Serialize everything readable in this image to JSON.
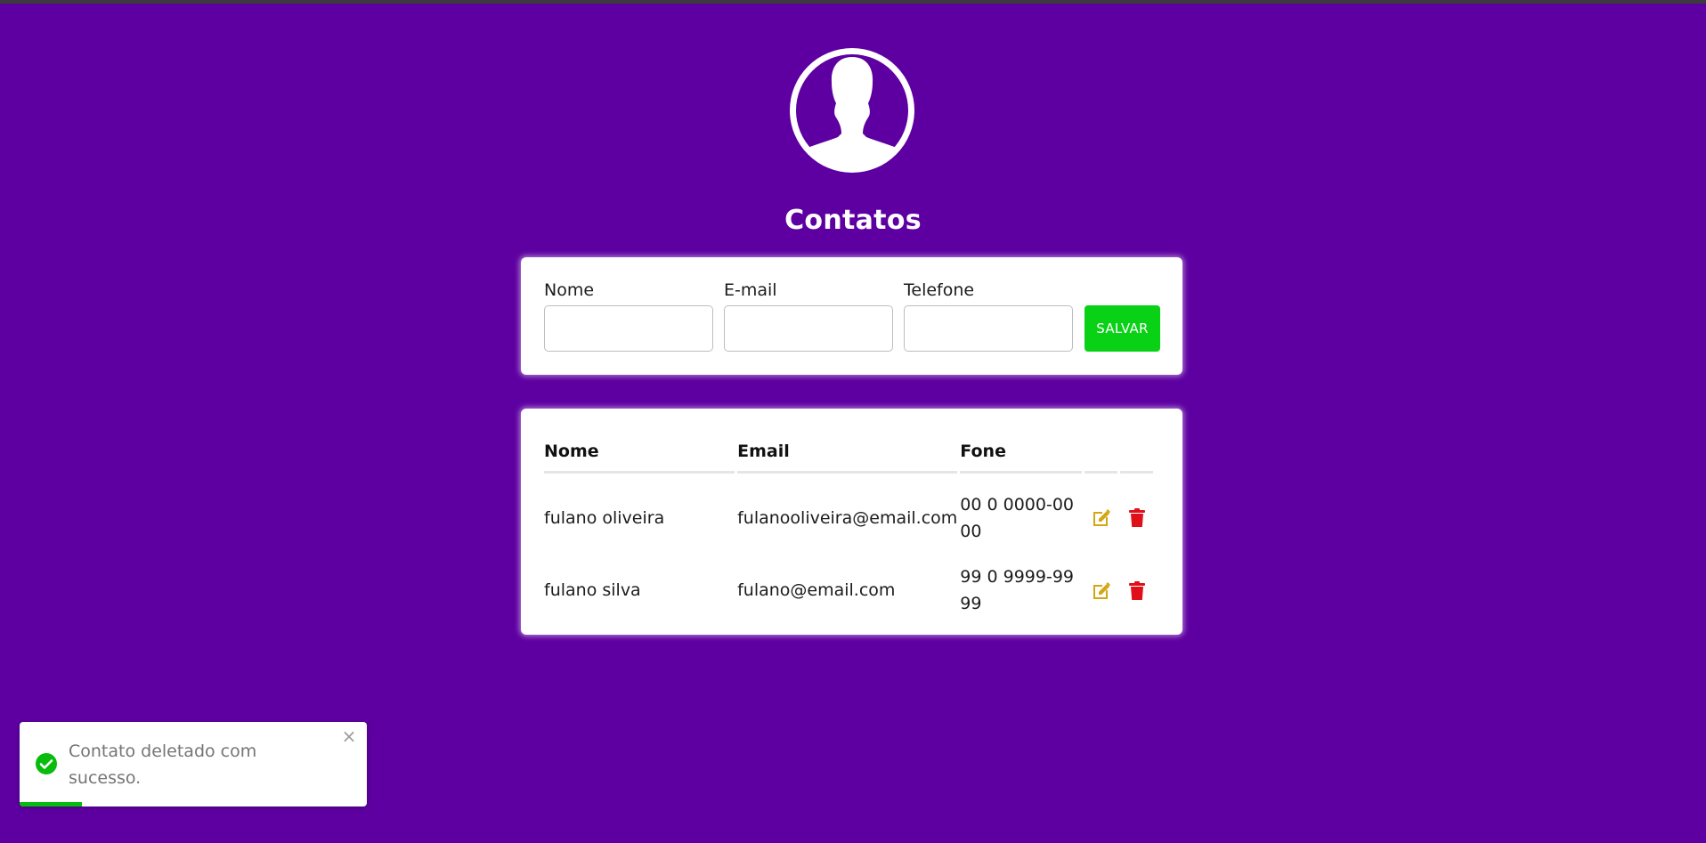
{
  "page": {
    "title": "Contatos"
  },
  "form": {
    "name_label": "Nome",
    "email_label": "E-mail",
    "phone_label": "Telefone",
    "name_value": "",
    "email_value": "",
    "phone_value": "",
    "save_label": "SALVAR"
  },
  "table": {
    "headers": [
      "Nome",
      "Email",
      "Fone"
    ],
    "rows": [
      {
        "name": "fulano oliveira",
        "email": "fulanooliveira@email.com",
        "phone": "00 0 0000-0000"
      },
      {
        "name": "fulano silva",
        "email": "fulano@email.com",
        "phone": "99 0 9999-9999"
      }
    ]
  },
  "toast": {
    "message": "Contato deletado com sucesso.",
    "close": "×",
    "progress": 0.18
  },
  "colors": {
    "background": "#5e00a1",
    "save_button": "#08d116",
    "edit_icon": "#d4a612",
    "delete_icon": "#e0101a",
    "toast_success": "#07bc0c"
  },
  "icons": {
    "avatar": "user-avatar-icon",
    "edit": "edit-icon",
    "delete": "trash-icon",
    "toast_status": "check-circle-icon",
    "toast_close": "close-icon"
  }
}
